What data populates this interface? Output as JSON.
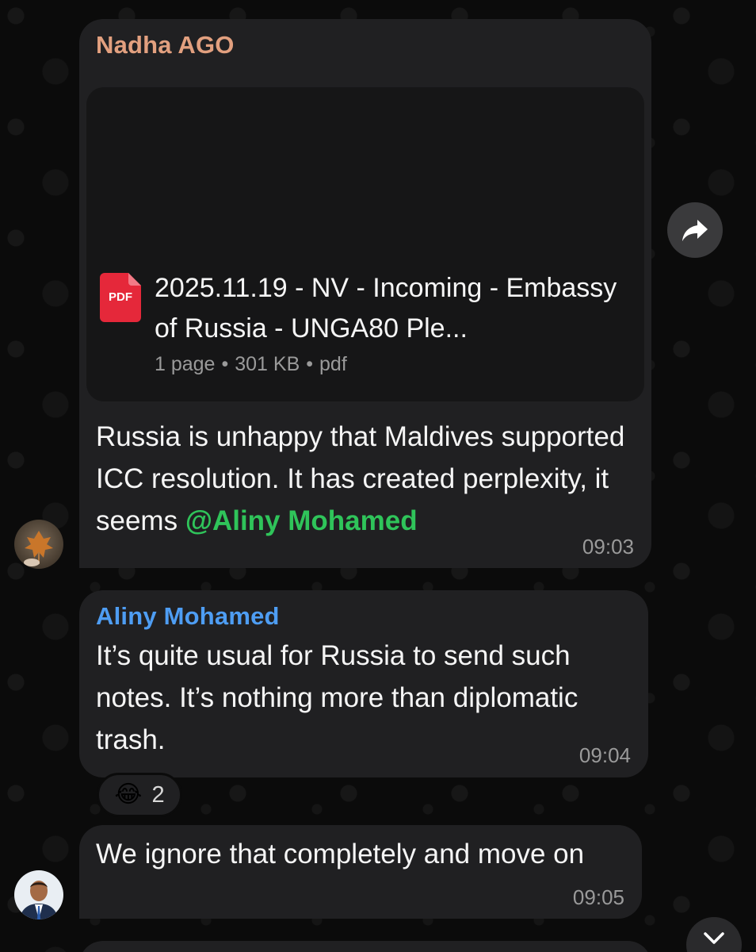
{
  "messages": [
    {
      "sender": "Nadha AGO",
      "sender_color": "#e2a07f",
      "attachment": {
        "type": "pdf",
        "icon_label": "PDF",
        "icon_name": "pdf-file-icon",
        "title": "2025.11.19 - NV - Incoming - Embassy of Russia - UNGA80 Ple...",
        "pages": "1 page",
        "size": "301 KB",
        "ext": "pdf"
      },
      "text_before_mention": "Russia is unhappy that Maldives supported ICC resolution. It has created perplexity, it seems ",
      "mention": "@Aliny Mohamed",
      "mention_color": "#2fc45a",
      "time": "09:03"
    },
    {
      "sender": "Aliny Mohamed",
      "sender_color": "#4e9df3",
      "text": "It’s quite usual for Russia to send such notes. It’s nothing more than diplomatic trash.",
      "time": "09:04",
      "reaction": {
        "emoji": "😂",
        "count": "2"
      }
    },
    {
      "text": "We ignore that completely and move on",
      "time": "09:05"
    }
  ],
  "controls": {
    "forward_icon": "forward-arrow-icon",
    "scroll_down_icon": "chevron-down-icon"
  },
  "colors": {
    "background": "#0b0b0b",
    "bubble": "#202022",
    "pdf_red": "#e5283a"
  }
}
